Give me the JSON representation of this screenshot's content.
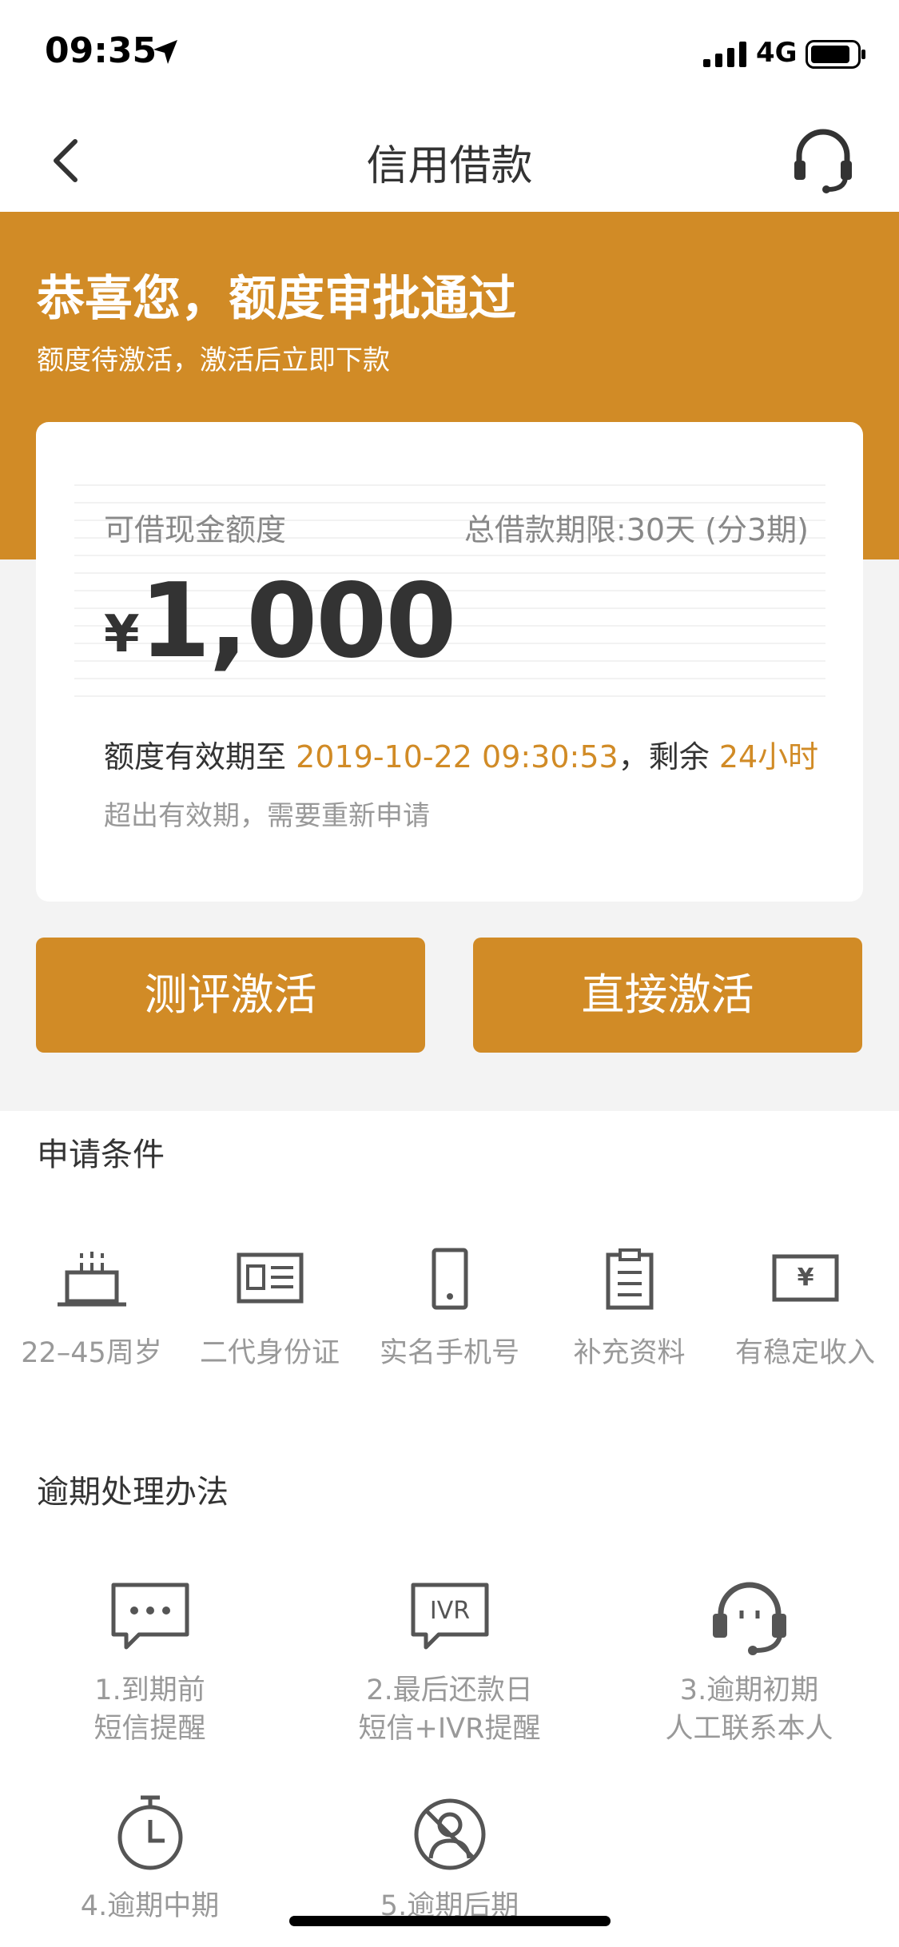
{
  "status_bar": {
    "time": "09:35",
    "network": "4G"
  },
  "nav": {
    "title": "信用借款"
  },
  "hero": {
    "headline": "恭喜您，额度审批通过",
    "subline": "额度待激活，激活后立即下款",
    "accent_color": "#d18b26"
  },
  "card": {
    "label": "可借现金额度",
    "term": "总借款期限:30天 (分3期)",
    "currency": "¥",
    "amount": "1,000",
    "valid_prefix": "额度有效期至",
    "valid_date": "2019-10-22 09:30:53",
    "valid_mid": "，剩余",
    "remaining": "24小时",
    "note": "超出有效期，需要重新申请"
  },
  "buttons": {
    "evaluate": "测评激活",
    "direct": "直接激活"
  },
  "conditions": {
    "title": "申请条件",
    "items": [
      {
        "label": "22–45周岁",
        "icon": "cake-icon"
      },
      {
        "label": "二代身份证",
        "icon": "id-card-icon"
      },
      {
        "label": "实名手机号",
        "icon": "phone-icon"
      },
      {
        "label": "补充资料",
        "icon": "clipboard-icon"
      },
      {
        "label": "有稳定收入",
        "icon": "income-icon"
      }
    ]
  },
  "overdue": {
    "title": "逾期处理办法",
    "items": [
      {
        "line1": "1.到期前",
        "line2": "短信提醒",
        "icon": "sms-icon"
      },
      {
        "line1": "2.最后还款日",
        "line2": "短信+IVR提醒",
        "icon": "ivr-icon",
        "icon_text": "IVR"
      },
      {
        "line1": "3.逾期初期",
        "line2": "人工联系本人",
        "icon": "headset-icon"
      },
      {
        "line1": "4.逾期中期",
        "line2": "",
        "icon": "stopwatch-icon"
      },
      {
        "line1": "5.逾期后期",
        "line2": "",
        "icon": "no-person-icon"
      }
    ]
  }
}
